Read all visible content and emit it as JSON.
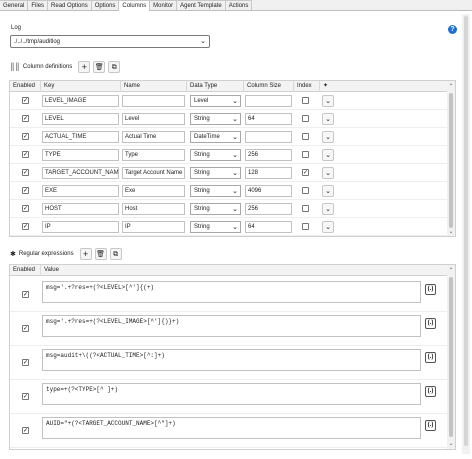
{
  "tabs": [
    "General",
    "Files",
    "Read Options",
    "Options",
    "Columns",
    "Monitor",
    "Agent Template",
    "Actions"
  ],
  "active_tab": "Columns",
  "log": {
    "label": "Log",
    "value": "./../../tmp/auditlog"
  },
  "help_icon": "?",
  "column_definitions": {
    "title": "Column definitions",
    "headers": {
      "enabled": "Enabled",
      "key": "Key",
      "name": "Name",
      "data_type": "Data Type",
      "column_size": "Column Size",
      "index": "Index",
      "action": "✦"
    },
    "rows": [
      {
        "enabled": true,
        "key": "LEVEL_IMAGE",
        "name": "",
        "data_type": "Level",
        "size": "",
        "index": false
      },
      {
        "enabled": true,
        "key": "LEVEL",
        "name": "Level",
        "data_type": "String",
        "size": "64",
        "index": false
      },
      {
        "enabled": true,
        "key": "ACTUAL_TIME",
        "name": "Actual Time",
        "data_type": "DateTime",
        "size": "",
        "index": false
      },
      {
        "enabled": true,
        "key": "TYPE",
        "name": "Type",
        "data_type": "String",
        "size": "256",
        "index": false
      },
      {
        "enabled": true,
        "key": "TARGET_ACCOUNT_NAME",
        "name": "Target Account Name",
        "data_type": "String",
        "size": "128",
        "index": true
      },
      {
        "enabled": true,
        "key": "EXE",
        "name": "Exe",
        "data_type": "String",
        "size": "4096",
        "index": false
      },
      {
        "enabled": true,
        "key": "HOST",
        "name": "Host",
        "data_type": "String",
        "size": "256",
        "index": false
      },
      {
        "enabled": true,
        "key": "IP",
        "name": "IP",
        "data_type": "String",
        "size": "64",
        "index": false
      }
    ]
  },
  "regular_expressions": {
    "title": "Regular expressions",
    "headers": {
      "enabled": "Enabled",
      "value": "Value"
    },
    "rows": [
      {
        "enabled": true,
        "value": "msg='.+?res=+(?<LEVEL>[^']{(+)"
      },
      {
        "enabled": true,
        "value": "msg='.+?res=+(?<LEVEL_IMAGE>[^']{)}+)"
      },
      {
        "enabled": true,
        "value": "msg=audit+\\((?<ACTUAL_TIME>[^:]+)"
      },
      {
        "enabled": true,
        "value": "type=+(?<TYPE>[^ ]+)"
      },
      {
        "enabled": true,
        "value": "AUID=\"+(?<TARGET_ACCOUNT_NAME>[^\"]+)"
      }
    ]
  },
  "icons": {
    "add": "+",
    "delete": "✕",
    "copy": "⧉",
    "chevron": "⌄",
    "check": "✓",
    "regex": "(.*)"
  }
}
